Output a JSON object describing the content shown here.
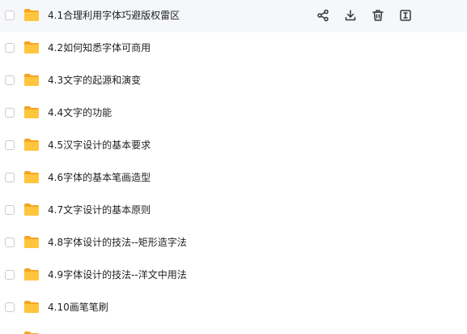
{
  "files": [
    {
      "name": "4.1合理利用字体巧避版权雷区",
      "type": "folder",
      "checked": false
    },
    {
      "name": "4.2如何知悉字体可商用",
      "type": "folder",
      "checked": false
    },
    {
      "name": "4.3文字的起源和演变",
      "type": "folder",
      "checked": false
    },
    {
      "name": "4.4文字的功能",
      "type": "folder",
      "checked": false
    },
    {
      "name": "4.5汉字设计的基本要求",
      "type": "folder",
      "checked": false
    },
    {
      "name": "4.6字体的基本笔画造型",
      "type": "folder",
      "checked": false
    },
    {
      "name": "4.7文字设计的基本原则",
      "type": "folder",
      "checked": false
    },
    {
      "name": "4.8字体设计的技法--矩形造字法",
      "type": "folder",
      "checked": false
    },
    {
      "name": "4.9字体设计的技法--洋文中用法",
      "type": "folder",
      "checked": false
    },
    {
      "name": "4.10画笔笔刷",
      "type": "folder",
      "checked": false
    }
  ],
  "hover_actions": [
    {
      "icon": "share-icon"
    },
    {
      "icon": "download-icon"
    },
    {
      "icon": "delete-icon"
    },
    {
      "icon": "rename-icon"
    }
  ],
  "colors": {
    "folder": "#ffc53d",
    "folder_tab": "#f5a623",
    "hover_row": "#f6f7fa",
    "icon": "#34363d"
  }
}
